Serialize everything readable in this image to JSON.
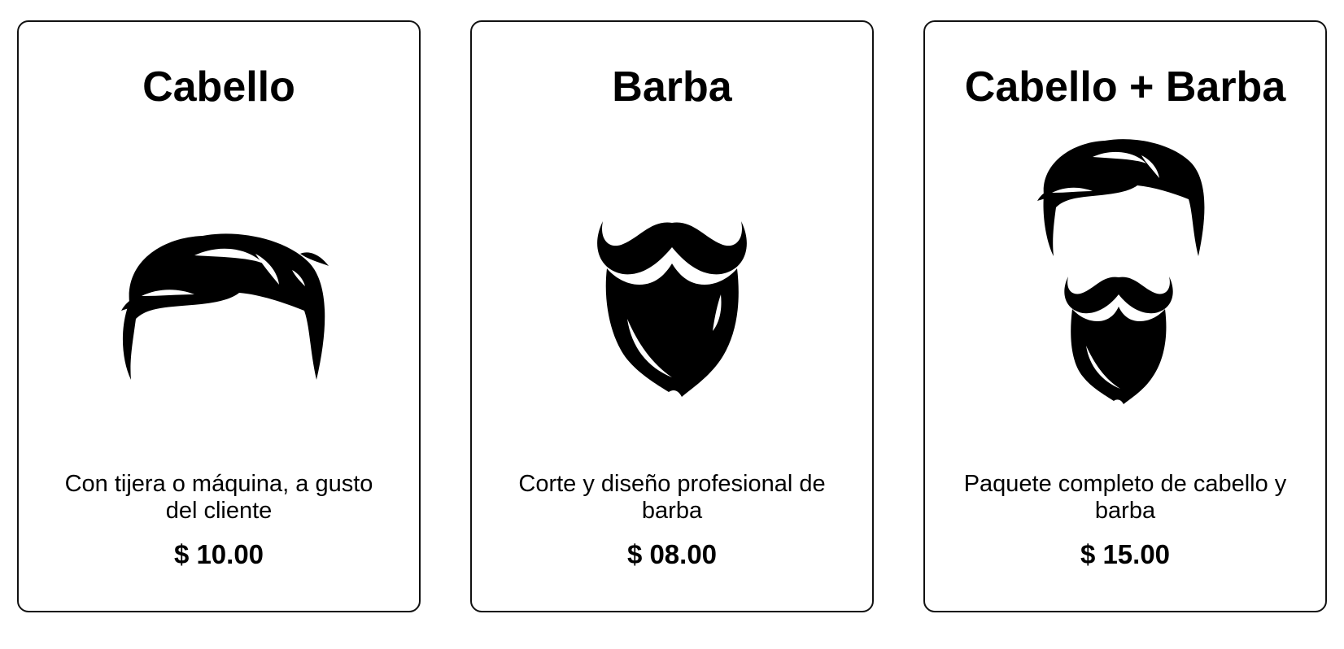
{
  "services": [
    {
      "title": "Cabello",
      "icon": "hair-icon",
      "description": "Con tijera o máquina, a gusto del cliente",
      "price": "$ 10.00"
    },
    {
      "title": "Barba",
      "icon": "beard-icon",
      "description": "Corte y diseño profesional de barba",
      "price": "$ 08.00"
    },
    {
      "title": "Cabello + Barba",
      "icon": "hair-and-beard-icon",
      "description": "Paquete completo de cabello y barba",
      "price": "$ 15.00"
    }
  ],
  "colors": {
    "border": "#111111",
    "text": "#000000",
    "background": "#ffffff"
  }
}
